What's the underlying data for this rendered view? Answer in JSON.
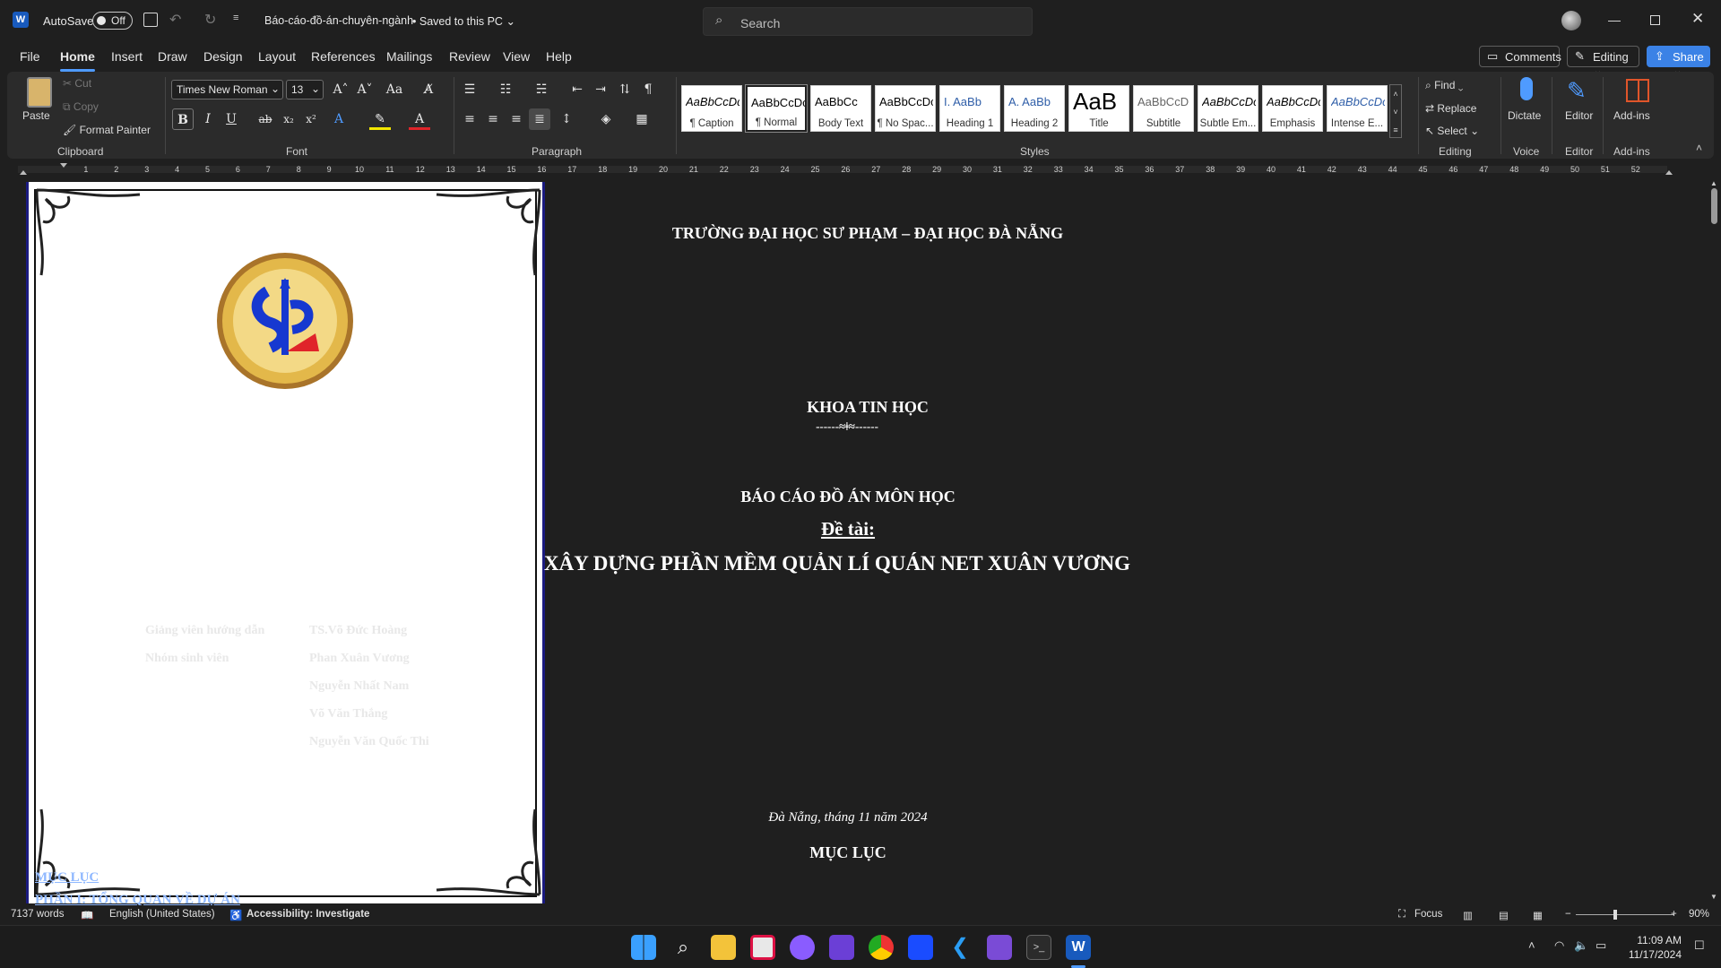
{
  "titlebar": {
    "autosave_label": "AutoSave",
    "autosave_state": "Off",
    "document_title": "Báo-cáo-đồ-án-chuyên-ngành",
    "save_status": "Saved to this PC",
    "search_placeholder": "Search"
  },
  "menu": {
    "items": [
      "File",
      "Home",
      "Insert",
      "Draw",
      "Design",
      "Layout",
      "References",
      "Mailings",
      "Review",
      "View",
      "Help"
    ],
    "active": "Home",
    "comments_label": "Comments",
    "editing_label": "Editing",
    "share_label": "Share"
  },
  "ribbon": {
    "clipboard": {
      "paste": "Paste",
      "cut": "Cut",
      "copy": "Copy",
      "format_painter": "Format Painter",
      "label": "Clipboard"
    },
    "font": {
      "family": "Times New Roman",
      "size": "13",
      "label": "Font"
    },
    "paragraph": {
      "label": "Paragraph"
    },
    "styles": {
      "label": "Styles",
      "items": [
        {
          "sample": "AaBbCcDdE",
          "name": "¶ Caption"
        },
        {
          "sample": "AaBbCcDc",
          "name": "¶ Normal"
        },
        {
          "sample": "AaBbCc",
          "name": "Body Text"
        },
        {
          "sample": "AaBbCcDc",
          "name": "¶ No Spac..."
        },
        {
          "sample": "I. AaBb",
          "name": "Heading 1"
        },
        {
          "sample": "A. AaBb",
          "name": "Heading 2"
        },
        {
          "sample": "AaB",
          "name": "Title"
        },
        {
          "sample": "AaBbCcD",
          "name": "Subtitle"
        },
        {
          "sample": "AaBbCcDc",
          "name": "Subtle Em..."
        },
        {
          "sample": "AaBbCcDc",
          "name": "Emphasis"
        },
        {
          "sample": "AaBbCcDc",
          "name": "Intense E..."
        }
      ]
    },
    "editing": {
      "find": "Find",
      "replace": "Replace",
      "select": "Select",
      "label": "Editing"
    },
    "voice": {
      "dictate": "Dictate",
      "label": "Voice"
    },
    "editor": {
      "editor": "Editor",
      "label": "Editor"
    },
    "addins": {
      "addins": "Add-ins",
      "label": "Add-ins"
    }
  },
  "document": {
    "university": "TRƯỜNG ĐẠI HỌC SƯ PHẠM – ĐẠI HỌC ĐÀ NẴNG",
    "faculty": "KHOA TIN HỌC",
    "ornament": "------≈ǂ≈------",
    "report_type": "BÁO CÁO ĐỒ ÁN MÔN HỌC",
    "topic_label": "Đề tài:",
    "project_title": "XÂY DỰNG PHẦN MỀM QUẢN LÍ QUÁN NET XUÂN VƯƠNG",
    "advisor_label": "Giảng viên hướng dẫn",
    "advisor_name": "TS.Võ Đức Hoàng",
    "team_label": "Nhóm sinh viên",
    "members": [
      "Phan Xuân Vương",
      "Nguyễn Nhất Nam",
      "Võ Văn Thắng",
      "Nguyễn Văn Quốc Thi"
    ],
    "place_date": "Đà Nẵng, tháng 11 năm 2024",
    "toc_heading": "MỤC LỤC",
    "toc_link_1": "MỤC LỤC",
    "toc_link_2": "PHẦN I: TỔNG QUAN VỀ DỰ ÁN"
  },
  "statusbar": {
    "words": "7137 words",
    "language": "English (United States)",
    "accessibility": "Accessibility: Investigate",
    "focus": "Focus",
    "zoom": "90%"
  },
  "taskbar": {
    "time": "11:09 AM",
    "date": "11/17/2024"
  },
  "colors": {
    "accent": "#4f9bff",
    "share": "#3b82e6",
    "word_blue": "#185abd"
  }
}
